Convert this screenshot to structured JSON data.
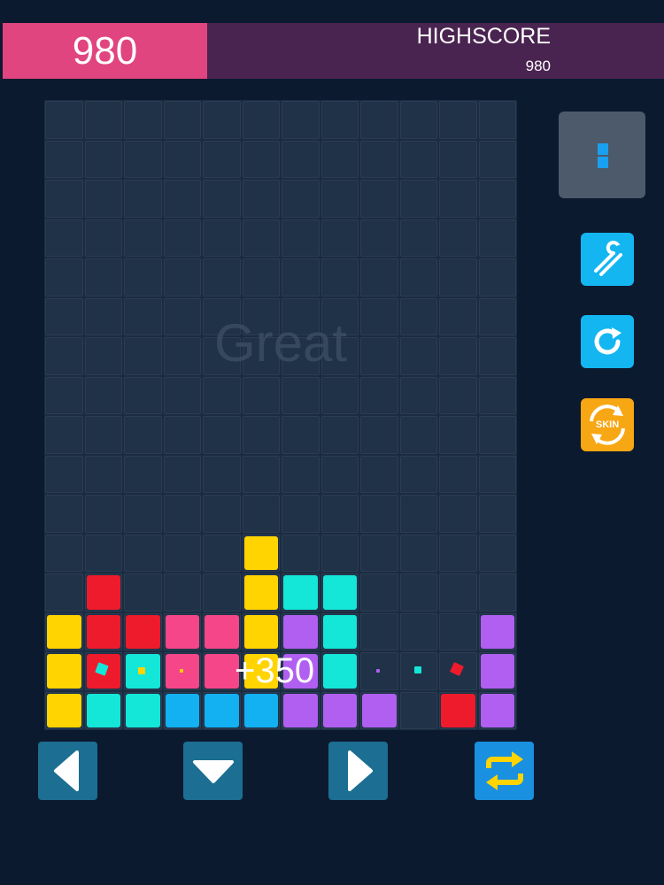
{
  "score": {
    "current": "980",
    "highscore_label": "HIGHSCORE",
    "highscore_value": "980"
  },
  "board": {
    "cols": 12,
    "rows": 16,
    "message": "Great",
    "points_popup": "+350",
    "colors": {
      "Y": "#ffd400",
      "R": "#ee1b2c",
      "P": "#f5468a",
      "C": "#14e6d8",
      "B": "#13b0f2",
      "V": "#b05ff0"
    },
    "blocks": [
      [
        11,
        5,
        "Y"
      ],
      [
        12,
        1,
        "R"
      ],
      [
        12,
        5,
        "Y"
      ],
      [
        12,
        6,
        "C"
      ],
      [
        12,
        7,
        "C"
      ],
      [
        13,
        0,
        "Y"
      ],
      [
        13,
        1,
        "R"
      ],
      [
        13,
        2,
        "R"
      ],
      [
        13,
        3,
        "P"
      ],
      [
        13,
        4,
        "P"
      ],
      [
        13,
        5,
        "Y"
      ],
      [
        13,
        6,
        "V"
      ],
      [
        13,
        7,
        "C"
      ],
      [
        13,
        11,
        "V"
      ],
      [
        14,
        0,
        "Y"
      ],
      [
        14,
        1,
        "R"
      ],
      [
        14,
        2,
        "C"
      ],
      [
        14,
        3,
        "P"
      ],
      [
        14,
        4,
        "P"
      ],
      [
        14,
        5,
        "Y"
      ],
      [
        14,
        6,
        "V"
      ],
      [
        14,
        7,
        "C"
      ],
      [
        14,
        11,
        "V"
      ],
      [
        15,
        0,
        "Y"
      ],
      [
        15,
        1,
        "C"
      ],
      [
        15,
        2,
        "C"
      ],
      [
        15,
        3,
        "B"
      ],
      [
        15,
        4,
        "B"
      ],
      [
        15,
        5,
        "B"
      ],
      [
        15,
        6,
        "V"
      ],
      [
        15,
        7,
        "V"
      ],
      [
        15,
        8,
        "V"
      ],
      [
        15,
        10,
        "R"
      ],
      [
        15,
        11,
        "V"
      ]
    ]
  },
  "side": {
    "next_label": "next-piece",
    "skin_label": "SKIN"
  },
  "controls": [
    "left",
    "down",
    "right",
    "rotate"
  ]
}
